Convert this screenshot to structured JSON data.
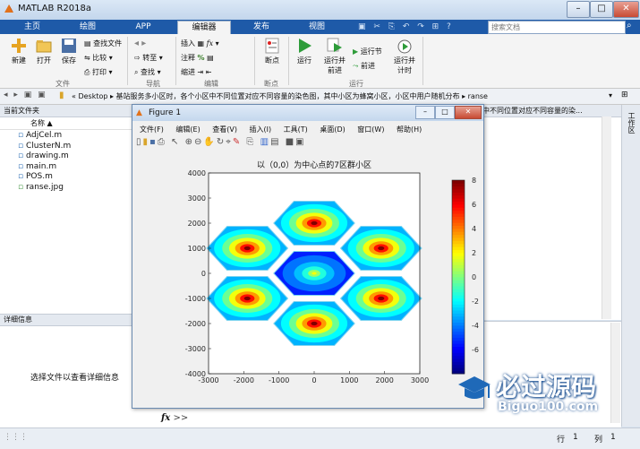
{
  "app": {
    "title": "MATLAB R2018a"
  },
  "tabs": [
    "主页",
    "绘图",
    "APP",
    "编辑器",
    "发布",
    "视图"
  ],
  "active_tab": "编辑器",
  "search_placeholder": "搜索文档",
  "ribbon": {
    "new": "新建",
    "open": "打开",
    "save": "保存",
    "find_files": "查找文件",
    "compare": "比较",
    "print": "打印",
    "goto": "转至",
    "find": "查找",
    "insert": "插入",
    "comment": "注释",
    "indent": "缩进",
    "breakpoints": "断点",
    "run": "运行",
    "run_advance_1": "运行并",
    "run_advance_2": "前进",
    "run_section": "运行节",
    "advance": "前进",
    "run_time_1": "运行并",
    "run_time_2": "计时",
    "group_file": "文件",
    "group_nav": "导航",
    "group_edit": "编辑",
    "group_bp": "断点",
    "group_run": "运行"
  },
  "address": {
    "path": "« Desktop ▸ 基站服务多小区时，各个小区中不同位置对应不同容量的染色图，其中小区为蜂窝小区，小区中用户随机分布 ▸ ranse"
  },
  "current_folder": {
    "title": "当前文件夹",
    "column": "名称 ▲",
    "files": [
      "AdjCel.m",
      "ClusterN.m",
      "drawing.m",
      "main.m",
      "POS.m",
      "ranse.jpg"
    ]
  },
  "details": {
    "title": "详细信息",
    "empty_text": "选择文件以查看详细信息"
  },
  "right_panel": {
    "text": "中不同位置对应不同容量的染..."
  },
  "workspace_tab": "工作区",
  "command": {
    "fx": "fx",
    "prompt": ">>"
  },
  "status": {
    "row_label": "行",
    "row": "1",
    "col_label": "列",
    "col": "1"
  },
  "figure": {
    "title": "Figure 1",
    "menus": [
      "文件(F)",
      "编辑(E)",
      "查看(V)",
      "插入(I)",
      "工具(T)",
      "桌面(D)",
      "窗口(W)",
      "帮助(H)"
    ]
  },
  "watermark": {
    "text": "必过源码",
    "url": "Biguo100.com"
  },
  "colors": {
    "tab_blue": "#1e5aa8",
    "ribbon_bg": "#f4f4f4"
  },
  "chart_data": {
    "type": "heatmap",
    "title": "以（0,0）为中心点的7区群小区",
    "xlim": [
      -3000,
      3000
    ],
    "ylim": [
      -4000,
      4000
    ],
    "xticks": [
      -3000,
      -2000,
      -1000,
      0,
      1000,
      2000,
      3000
    ],
    "yticks": [
      -4000,
      -3000,
      -2000,
      -1000,
      0,
      1000,
      2000,
      3000,
      4000
    ],
    "colorbar": {
      "min": -8,
      "max": 8,
      "ticks": [
        8,
        6,
        4,
        2,
        0,
        -2,
        -4,
        -6
      ]
    },
    "cells": [
      {
        "x": 0,
        "y": 0,
        "peak": 2
      },
      {
        "x": 0,
        "y": 2000,
        "peak": 8
      },
      {
        "x": 0,
        "y": -2000,
        "peak": 8
      },
      {
        "x": 1900,
        "y": 1000,
        "peak": 8
      },
      {
        "x": -1900,
        "y": 1000,
        "peak": 8
      },
      {
        "x": 1900,
        "y": -1000,
        "peak": 8
      },
      {
        "x": -1900,
        "y": -1000,
        "peak": 8
      }
    ],
    "grid": false
  }
}
